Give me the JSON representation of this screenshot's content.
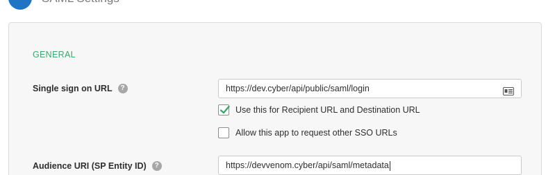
{
  "header": {
    "step_title": "SAML Settings"
  },
  "panel": {
    "section_heading": "GENERAL",
    "sso_url": {
      "label": "Single sign on URL",
      "help_glyph": "?",
      "value": "https://dev.cyber/api/public/saml/login",
      "trailing_icon": "id-card-icon"
    },
    "recipient_checkbox": {
      "label": "Use this for Recipient URL and Destination URL",
      "checked": true
    },
    "other_sso_checkbox": {
      "label": "Allow this app to request other SSO URLs",
      "checked": false
    },
    "audience_uri": {
      "label": "Audience URI (SP Entity ID)",
      "help_glyph": "?",
      "value": "https://devvenom.cyber/api/saml/metadata"
    }
  },
  "colors": {
    "accent_green": "#3aa76d",
    "brand_blue": "#1f75c4",
    "check_green": "#3aa76d"
  }
}
